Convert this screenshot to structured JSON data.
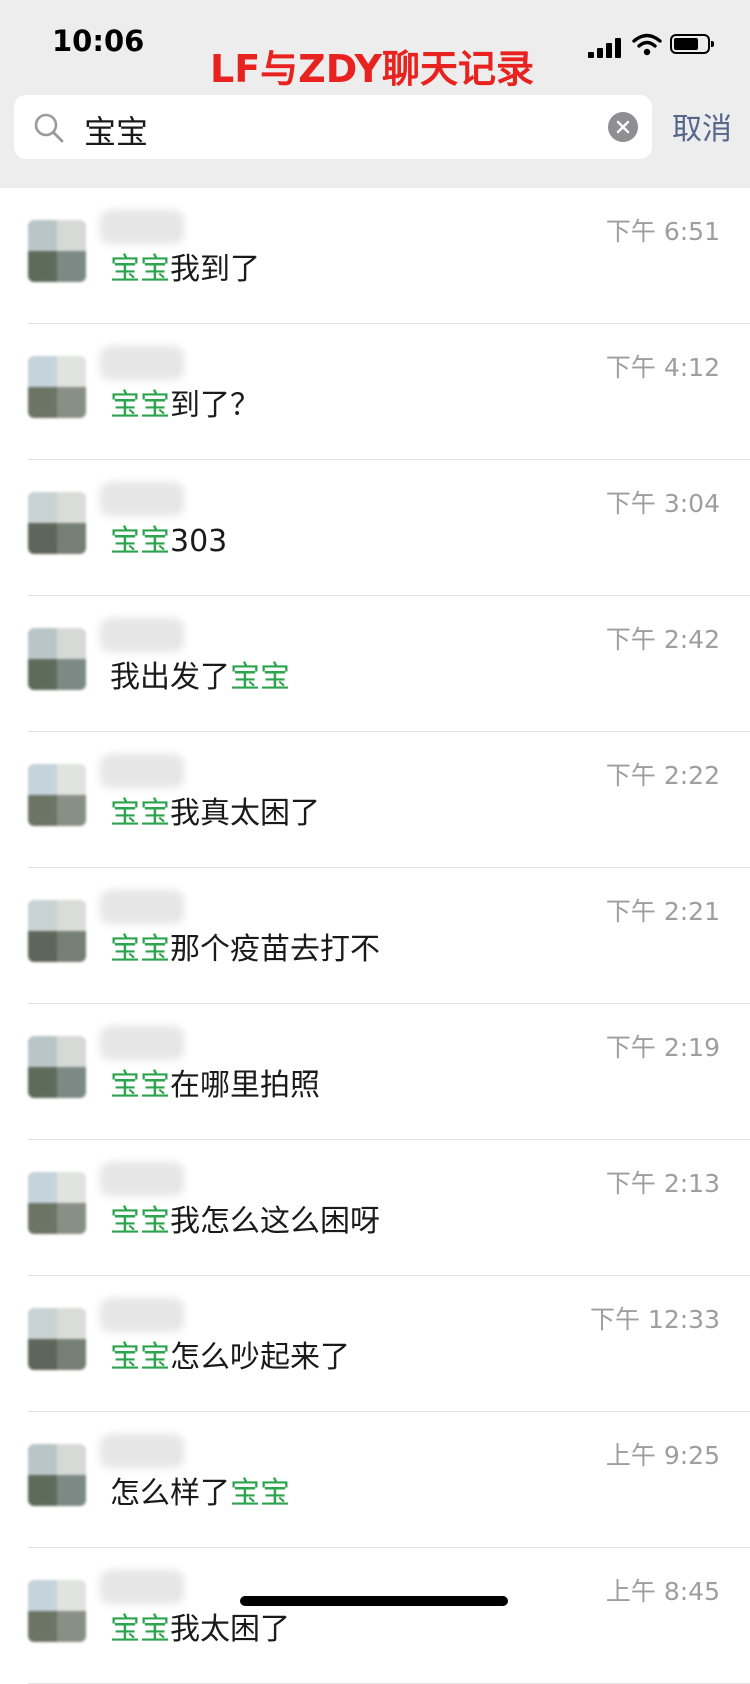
{
  "status_bar": {
    "time": "10:06",
    "battery_level": 0.75
  },
  "overlay_title": "LF与ZDY聊天记录",
  "search": {
    "query": "宝宝",
    "cancel_label": "取消"
  },
  "results": [
    {
      "time": "下午 6:51",
      "parts": [
        {
          "text": "宝宝",
          "hl": true
        },
        {
          "text": "我到了",
          "hl": false
        }
      ]
    },
    {
      "time": "下午 4:12",
      "parts": [
        {
          "text": "宝宝",
          "hl": true
        },
        {
          "text": "到了？",
          "hl": false
        }
      ]
    },
    {
      "time": "下午 3:04",
      "parts": [
        {
          "text": "宝宝",
          "hl": true
        },
        {
          "text": "303",
          "hl": false
        }
      ]
    },
    {
      "time": "下午 2:42",
      "parts": [
        {
          "text": "我出发了",
          "hl": false
        },
        {
          "text": "宝宝",
          "hl": true
        }
      ]
    },
    {
      "time": "下午 2:22",
      "parts": [
        {
          "text": "宝宝",
          "hl": true
        },
        {
          "text": "我真太困了",
          "hl": false
        }
      ]
    },
    {
      "time": "下午 2:21",
      "parts": [
        {
          "text": "宝宝",
          "hl": true
        },
        {
          "text": "那个疫苗去打不",
          "hl": false
        }
      ]
    },
    {
      "time": "下午 2:19",
      "parts": [
        {
          "text": "宝宝",
          "hl": true
        },
        {
          "text": "在哪里拍照",
          "hl": false
        }
      ]
    },
    {
      "time": "下午 2:13",
      "parts": [
        {
          "text": "宝宝",
          "hl": true
        },
        {
          "text": "我怎么这么困呀",
          "hl": false
        }
      ]
    },
    {
      "time": "下午 12:33",
      "parts": [
        {
          "text": "宝宝",
          "hl": true
        },
        {
          "text": "怎么吵起来了",
          "hl": false
        }
      ]
    },
    {
      "time": "上午 9:25",
      "parts": [
        {
          "text": "怎么样了",
          "hl": false
        },
        {
          "text": "宝宝",
          "hl": true
        }
      ]
    },
    {
      "time": "上午 8:45",
      "parts": [
        {
          "text": "宝宝",
          "hl": true
        },
        {
          "text": "我太困了",
          "hl": false
        }
      ]
    }
  ],
  "colors": {
    "highlight": "#2ca44e",
    "overlay_title": "#e8231f",
    "cancel": "#56658a",
    "time": "#9e9e9e"
  }
}
